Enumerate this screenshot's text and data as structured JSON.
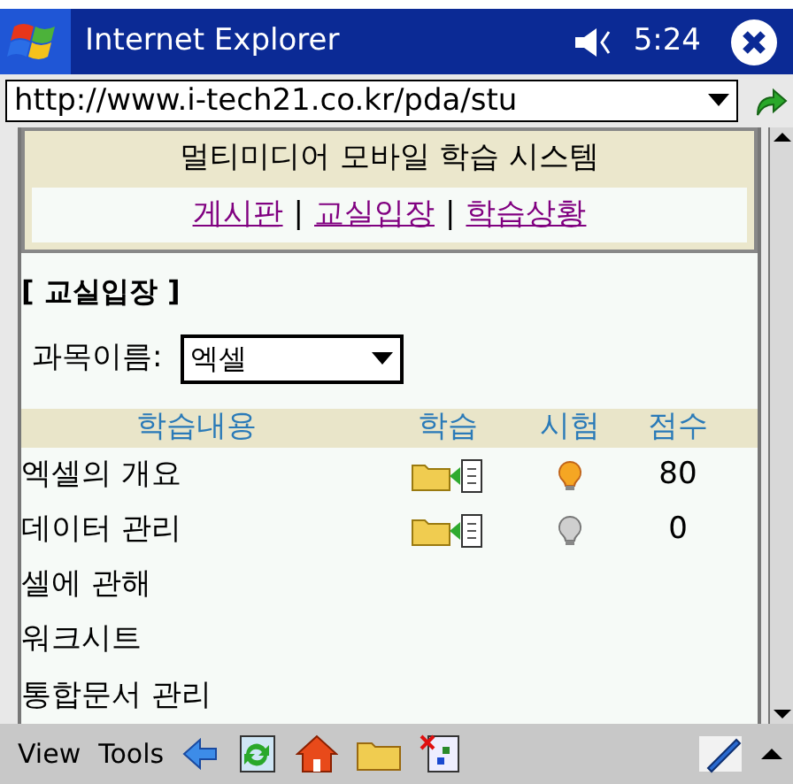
{
  "window": {
    "title": "Internet Explorer",
    "time": "5:24"
  },
  "address_bar": {
    "value": "http://www.i-tech21.co.kr/pda/stu"
  },
  "page": {
    "title": "멀티미디어 모바일 학습 시스템",
    "nav_links": [
      {
        "label": "게시판"
      },
      {
        "label": "교실입장"
      },
      {
        "label": "학습상황"
      }
    ],
    "separator": "|",
    "section_title": "[ 교실입장 ]",
    "course_label": "과목이름:",
    "course_select": {
      "value": "엑셀"
    },
    "table": {
      "columns": [
        "학습내용",
        "학습",
        "시험",
        "점수"
      ],
      "rows": [
        {
          "kind": "scored",
          "title": "엑셀의 개요",
          "test_passed": true,
          "score": "80"
        },
        {
          "kind": "scored",
          "title": "데이터 관리",
          "test_passed": false,
          "score": "0"
        },
        {
          "kind": "plain",
          "title": "셀에 관해"
        },
        {
          "kind": "plain",
          "title": "워크시트"
        },
        {
          "kind": "plain",
          "title": "통합문서 관리"
        }
      ]
    }
  },
  "menu_bar": {
    "items": [
      "View",
      "Tools"
    ]
  }
}
